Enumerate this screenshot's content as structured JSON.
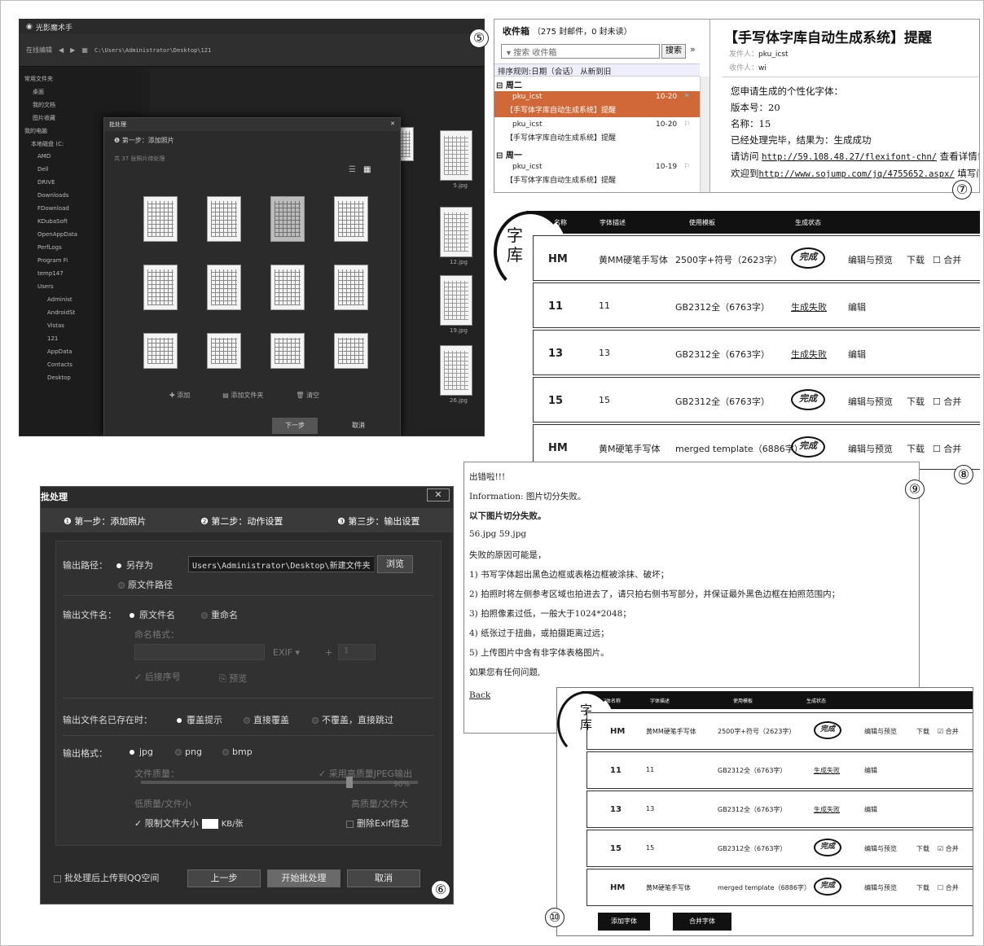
{
  "markers": [
    "⑤",
    "⑥",
    "⑦",
    "⑧",
    "⑨",
    "⑩"
  ],
  "photo_app": {
    "title": "光影魔术手",
    "toolbar_label": "在线编辑",
    "path": "C:\\Users\\Administrator\\Desktop\\121",
    "sidebar": [
      "常用文件夹",
      "桌面",
      "我的文档",
      "图片收藏",
      "我的电脑",
      "本地磁盘 (C:",
      "AMD",
      "Dell",
      "DRIVE",
      "Downloads",
      "FDownload",
      "KDubaSoft",
      "OpenAppData",
      "PerfLogs",
      "Program Fi",
      "temp147",
      "Users",
      "Administ",
      "AndroidSt",
      "Vistas",
      "121",
      "AppData",
      "Contacts",
      "Desktop"
    ],
    "side_captions": [
      "5.jpg",
      "12.jpg",
      "19.jpg",
      "26.jpg"
    ],
    "dialog": {
      "title": "批处理",
      "close": "✕",
      "step": "第一步：添加照片",
      "count": "共 37 张照片待处理",
      "actions": [
        "添加",
        "添加文件夹",
        "清空"
      ],
      "next": "下一步",
      "cancel": "取消"
    }
  },
  "email": {
    "inbox_title": "收件箱",
    "inbox_count": "（275 封邮件，0 封未读）",
    "search_placeholder": "搜索 收件箱",
    "search_button": "搜索",
    "sort_label": "排序规则:日期（会话）   从新到旧",
    "groups": [
      "周二",
      "周一"
    ],
    "messages": [
      {
        "from": "pku_icst",
        "subject": "【手写体字库自动生成系统】提醒",
        "date": "10-20",
        "selected": true
      },
      {
        "from": "pku_icst",
        "subject": "【手写体字库自动生成系统】提醒",
        "date": "10-20",
        "selected": false
      },
      {
        "from": "pku_icst",
        "subject": "【手写体字库自动生成系统】提醒",
        "date": "10-19",
        "selected": false
      }
    ],
    "reading": {
      "subject": "【手写体字库自动生成系统】提醒",
      "from_label": "发件人：",
      "from": "pku_icst",
      "to_label": "收件人：",
      "to": "wi",
      "body": [
        "您申请生成的个性化字体：",
        "版本号：20",
        "名称：15",
        "已经处理完毕，结果为：生成成功"
      ],
      "visit_prefix": "请访问 ",
      "visit_link": "http://59.108.48.27/flexifont-chn/",
      "visit_suffix": " 查看详情!",
      "welcome_prefix": "欢迎到",
      "welcome_link": "http://www.sojump.com/jq/4755652.aspx/",
      "welcome_suffix": " 填写问"
    }
  },
  "library_large": {
    "logo": [
      "字",
      "库"
    ],
    "headers": [
      "字体名称",
      "字体描述",
      "使用模板",
      "生成状态"
    ],
    "rows": [
      {
        "name": "HM",
        "desc": "黄MM硬笔手写体",
        "template": "2500字+符号（2623字）",
        "status": "完成",
        "edit": "编辑与预览",
        "download": "下载",
        "merge": "合并"
      },
      {
        "name": "11",
        "desc": "11",
        "template": "GB2312全（6763字）",
        "status": "生成失败",
        "edit": "编辑",
        "download": "",
        "merge": ""
      },
      {
        "name": "13",
        "desc": "13",
        "template": "GB2312全（6763字）",
        "status": "生成失败",
        "edit": "编辑",
        "download": "",
        "merge": ""
      },
      {
        "name": "15",
        "desc": "15",
        "template": "GB2312全（6763字）",
        "status": "完成",
        "edit": "编辑与预览",
        "download": "下载",
        "merge": "合并"
      },
      {
        "name": "HM",
        "desc": "黄M硬笔手写体",
        "template": "merged template（6886字）",
        "status": "完成",
        "edit": "编辑与预览",
        "download": "下载",
        "merge": "合并"
      }
    ]
  },
  "batch": {
    "title": "批处理",
    "close": "✕",
    "steps": [
      "❶  第一步：添加照片",
      "❷  第二步：动作设置",
      "❸  第三步：输出设置"
    ],
    "output_path_label": "输出路径：",
    "save_as": "另存为",
    "path_value": "Users\\Administrator\\Desktop\\新建文件夹",
    "browse": "浏览",
    "original_path": "原文件路径",
    "filename_label": "输出文件名：",
    "original_name": "原文件名",
    "rename": "重命名",
    "naming_format": "命名格式：",
    "exif": "EXIF",
    "exif_num": "1",
    "append_seq": "后接序号",
    "preview": "预览",
    "exists_label": "输出文件名已存在时：",
    "exists_options": [
      "覆盖提示",
      "直接覆盖",
      "不覆盖，直接跳过"
    ],
    "format_label": "输出格式：",
    "formats": [
      "jpg",
      "png",
      "bmp"
    ],
    "quality_label": "文件质量：",
    "hq_label": "采用高质量JPEG输出",
    "quality_value": "90%",
    "low_q": "低质量/文件小",
    "high_q": "高质量/文件大",
    "limit_size": "限制文件大小",
    "size_unit": "KB/张",
    "remove_exif": "删除Exif信息",
    "upload_qq": "批处理后上传到QQ空间",
    "prev": "上一步",
    "start": "开始批处理",
    "cancel": "取消"
  },
  "error_page": {
    "lines": [
      "出错啦!!!",
      "Information: 图片切分失败。",
      "以下图片切分失败。",
      "56.jpg 59.jpg",
      "失败的原因可能是，",
      "1) 书写字体超出黑色边框或表格边框被涂抹、破坏；",
      "2) 拍照时将左侧参考区域也拍进去了，请只拍右侧书写部分，并保证最外黑色边框在拍照范围内；",
      "3) 拍照像素过低，一般大于1024*2048；",
      "4) 纸张过于扭曲，或拍摄距离过远；",
      "5) 上传图片中含有非字体表格图片。",
      "如果您有任何问题,",
      "Back"
    ]
  },
  "library_small": {
    "logo": [
      "字",
      "库"
    ],
    "headers": [
      "字体名称",
      "字体描述",
      "使用模板",
      "生成状态"
    ],
    "rows": [
      {
        "name": "HM",
        "desc": "黄MM硬笔手写体",
        "template": "2500字+符号（2623字）",
        "status": "完成",
        "edit": "编辑与预览",
        "download": "下载",
        "merge": "☑ 合并"
      },
      {
        "name": "11",
        "desc": "11",
        "template": "GB2312全（6763字）",
        "status": "生成失败",
        "edit": "编辑",
        "download": "",
        "merge": ""
      },
      {
        "name": "13",
        "desc": "13",
        "template": "GB2312全（6763字）",
        "status": "生成失败",
        "edit": "编辑",
        "download": "",
        "merge": ""
      },
      {
        "name": "15",
        "desc": "15",
        "template": "GB2312全（6763字）",
        "status": "完成",
        "edit": "编辑与预览",
        "download": "下载",
        "merge": "☑ 合并"
      },
      {
        "name": "HM",
        "desc": "黄M硬笔手写体",
        "template": "merged template（6886字）",
        "status": "完成",
        "edit": "编辑与预览",
        "download": "下载",
        "merge": "☐ 合并"
      }
    ],
    "buttons": [
      "添加字体",
      "合并字体"
    ]
  }
}
